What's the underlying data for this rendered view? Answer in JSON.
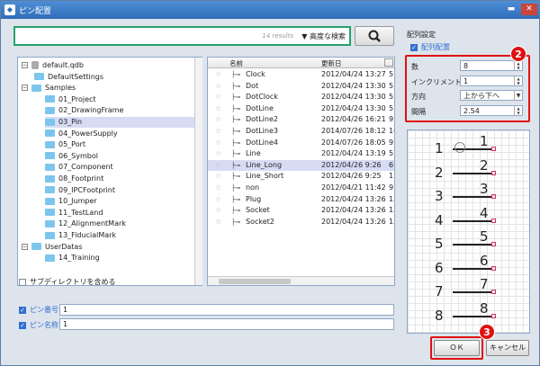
{
  "window": {
    "title": "ピン配置",
    "minimize": "▬",
    "close": "✕"
  },
  "search": {
    "count": "14 results",
    "advanced": "▼ 高度な検索"
  },
  "tree": {
    "root": "default.qdb",
    "items": [
      {
        "label": "DefaultSettings",
        "level": 1,
        "exp": ""
      },
      {
        "label": "Samples",
        "level": 0,
        "exp": "−"
      },
      {
        "label": "01_Project",
        "level": 2
      },
      {
        "label": "02_DrawingFrame",
        "level": 2
      },
      {
        "label": "03_Pin",
        "level": 2,
        "selected": true
      },
      {
        "label": "04_PowerSupply",
        "level": 2
      },
      {
        "label": "05_Port",
        "level": 2
      },
      {
        "label": "06_Symbol",
        "level": 2
      },
      {
        "label": "07_Component",
        "level": 2
      },
      {
        "label": "08_Footprint",
        "level": 2
      },
      {
        "label": "09_IPCFootprint",
        "level": 2
      },
      {
        "label": "10_Jumper",
        "level": 2
      },
      {
        "label": "11_TestLand",
        "level": 2
      },
      {
        "label": "12_AlignmentMark",
        "level": 2
      },
      {
        "label": "13_FiducialMark",
        "level": 2
      },
      {
        "label": "UserDatas",
        "level": 0,
        "exp": "−"
      },
      {
        "label": "14_Training",
        "level": 2
      }
    ],
    "subdir_label": "サブディレクトリを含める"
  },
  "list": {
    "col_name": "名前",
    "col_date": "更新日",
    "col_extra": "",
    "rows": [
      {
        "name": "Clock",
        "date": "2012/04/24 13:27",
        "x": "5"
      },
      {
        "name": "Dot",
        "date": "2012/04/24 13:30",
        "x": "5"
      },
      {
        "name": "DotClock",
        "date": "2012/04/24 13:30",
        "x": "5"
      },
      {
        "name": "DotLine",
        "date": "2012/04/24 13:30",
        "x": "5"
      },
      {
        "name": "DotLine2",
        "date": "2012/04/26 16:21",
        "x": "9"
      },
      {
        "name": "DotLine3",
        "date": "2014/07/26 18:12",
        "x": "16"
      },
      {
        "name": "DotLine4",
        "date": "2014/07/26 18:05",
        "x": "9"
      },
      {
        "name": "Line",
        "date": "2012/04/24 13:19",
        "x": "5"
      },
      {
        "name": "Line_Long",
        "date": "2012/04/26 9:26",
        "x": "6",
        "selected": true
      },
      {
        "name": "Line_Short",
        "date": "2012/04/26 9:25",
        "x": "11"
      },
      {
        "name": "non",
        "date": "2012/04/21 11:42",
        "x": "9"
      },
      {
        "name": "Plug",
        "date": "2012/04/24 13:26",
        "x": "13"
      },
      {
        "name": "Socket",
        "date": "2012/04/24 13:26",
        "x": "13"
      },
      {
        "name": "Socket2",
        "date": "2012/04/24 13:26",
        "x": "13"
      }
    ]
  },
  "bottom": {
    "pin_no_label": "ピン番号",
    "pin_no_value": "1",
    "pin_name_label": "ピン名称",
    "pin_name_value": "1"
  },
  "settings": {
    "group": "配列設定",
    "array_label": "配列配置",
    "count_label": "数",
    "count_value": "8",
    "inc_label": "インクリメント",
    "inc_value": "1",
    "dir_label": "方向",
    "dir_value": "上から下へ",
    "gap_label": "間隔",
    "gap_value": "2.54"
  },
  "preview": {
    "left": [
      "1",
      "2",
      "3",
      "4",
      "5",
      "6",
      "7",
      "8"
    ],
    "right": [
      "1",
      "2",
      "3",
      "4",
      "5",
      "6",
      "7",
      "8"
    ]
  },
  "buttons": {
    "ok": "ＯＫ",
    "cancel": "キャンセル"
  },
  "badges": {
    "b2": "2",
    "b3": "3"
  },
  "colors": {
    "accent": "#2f6fd0",
    "highlight": "#e01010",
    "search_border": "#27a26a"
  }
}
